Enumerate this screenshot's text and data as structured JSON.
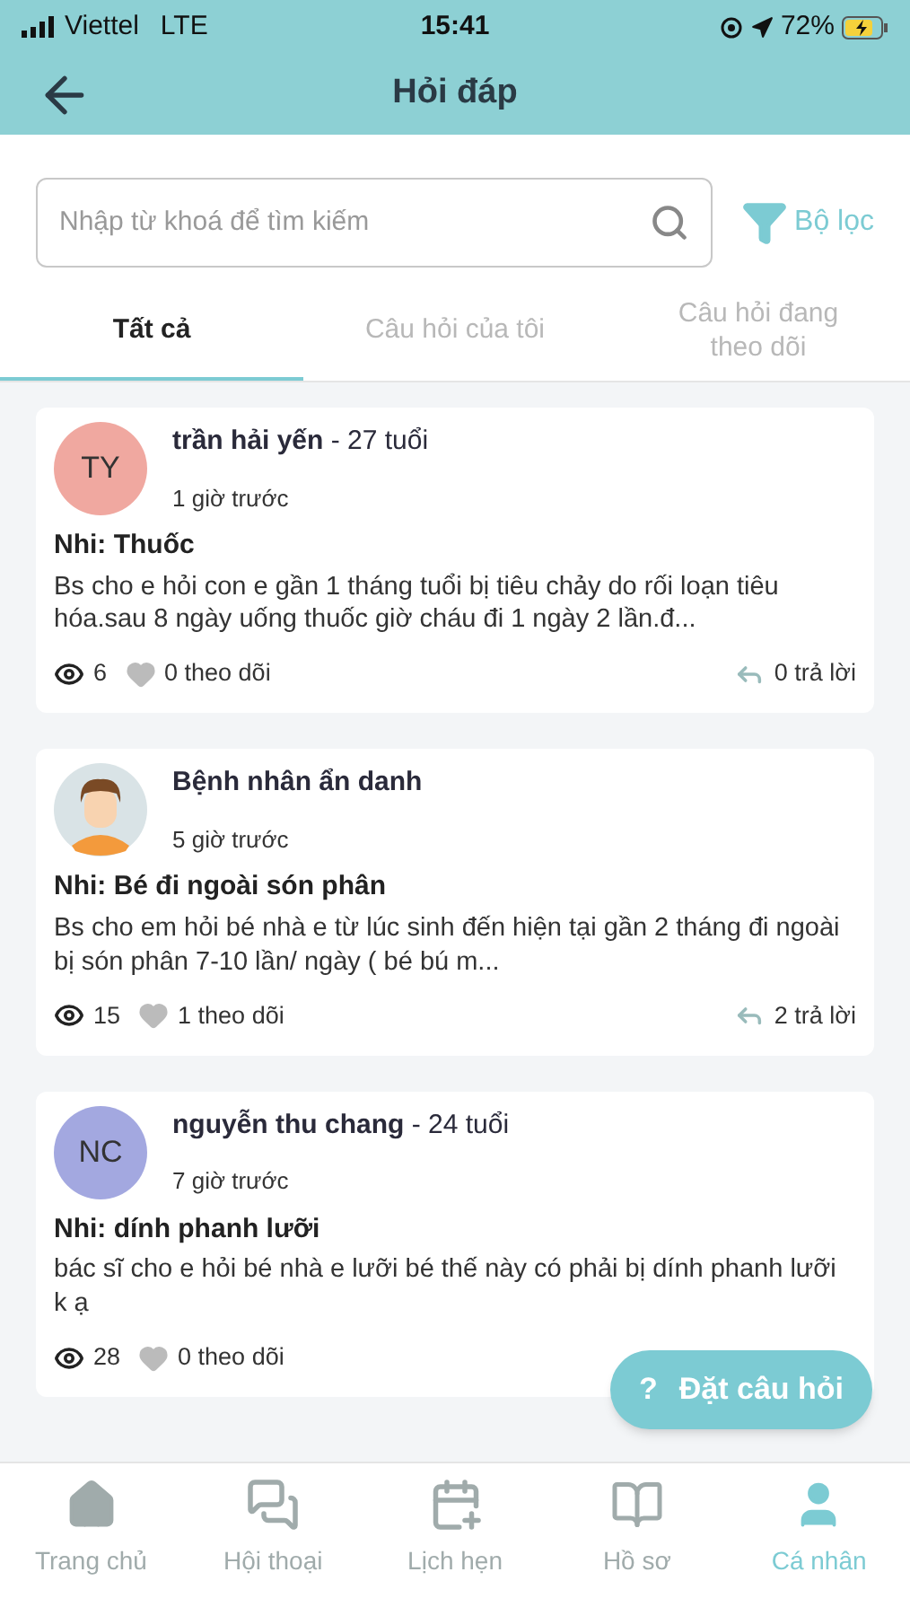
{
  "status_bar": {
    "carrier": "Viettel",
    "network": "LTE",
    "time": "15:41",
    "battery": "72%"
  },
  "header": {
    "title": "Hỏi đáp"
  },
  "search": {
    "placeholder": "Nhập từ khoá để tìm kiếm"
  },
  "filter": {
    "label": "Bộ lọc"
  },
  "tabs": [
    {
      "label": "Tất cả",
      "selected": true
    },
    {
      "label": "Câu hỏi của tôi",
      "selected": false
    },
    {
      "label": "Câu hỏi đang theo dõi",
      "selected": false
    }
  ],
  "questions": [
    {
      "avatar": {
        "kind": "initials",
        "initials": "TY",
        "color": "#f0a8a0"
      },
      "name": "trần hải yến",
      "age": "- 27 tuổi",
      "time": "1 giờ trước",
      "title": "Nhi: Thuốc",
      "body": "Bs cho e hỏi con e gần 1 tháng tuổi bị tiêu chảy do rối loạn tiêu hóa.sau 8 ngày uống thuốc giờ cháu đi 1 ngày 2 lần.đ...",
      "views": "6",
      "follows": "0 theo dõi",
      "replies": "0 trả lời"
    },
    {
      "avatar": {
        "kind": "illustration"
      },
      "name": "Bệnh nhân ẩn danh",
      "time": "5 giờ trước",
      "title": "Nhi: Bé đi ngoài són phân",
      "body": "Bs cho em hỏi bé nhà e từ lúc sinh đến hiện tại gần 2 tháng đi ngoài bị són phân 7-10 lần/ ngày ( bé bú m...",
      "views": "15",
      "follows": "1 theo dõi",
      "replies": "2 trả lời"
    },
    {
      "avatar": {
        "kind": "initials",
        "initials": "NC",
        "color": "#a3a8e0"
      },
      "name": "nguyễn thu chang",
      "age": "- 24 tuổi",
      "time": "7 giờ trước",
      "title": "Nhi: dính phanh lưỡi",
      "body": "bác sĩ cho e hỏi bé nhà e lưỡi bé thế này có phải bị dính phanh lưỡi k ạ",
      "views": "28",
      "follows": "0 theo dõi"
    }
  ],
  "fab": {
    "icon": "?",
    "label": "Đặt câu hỏi"
  },
  "bottom_nav": [
    {
      "label": "Trang chủ",
      "selected": false
    },
    {
      "label": "Hội thoại",
      "selected": false
    },
    {
      "label": "Lịch hẹn",
      "selected": false
    },
    {
      "label": "Hồ sơ",
      "selected": false
    },
    {
      "label": "Cá nhân",
      "selected": true
    }
  ]
}
